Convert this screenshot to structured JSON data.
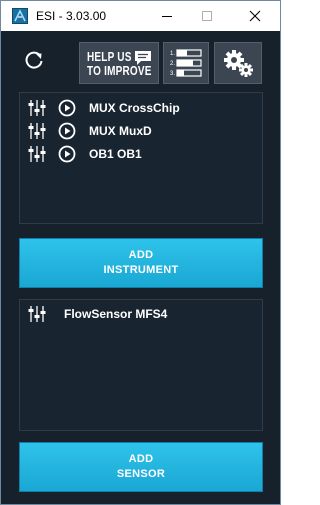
{
  "window": {
    "title": "ESI - 3.03.00"
  },
  "toolbar": {
    "refresh_icon": "refresh-icon",
    "help_line1": "HELP US",
    "help_line2": "TO IMPROVE",
    "help_icon": "chat-bubble-icon",
    "list_icon": "numbered-list-icon",
    "settings_icon": "gears-icon"
  },
  "instruments": {
    "items": [
      {
        "label": "MUX CrossChip"
      },
      {
        "label": "MUX MuxD"
      },
      {
        "label": "OB1 OB1"
      }
    ]
  },
  "add_instrument": {
    "line1": "ADD",
    "line2": "INSTRUMENT"
  },
  "sensors": {
    "items": [
      {
        "label": "FlowSensor MFS4"
      }
    ]
  },
  "add_sensor": {
    "line1": "ADD",
    "line2": "SENSOR"
  },
  "colors": {
    "background": "#16212c",
    "accent": "#22b6e3",
    "panel": "#182430",
    "button_dark": "#3b4652"
  }
}
